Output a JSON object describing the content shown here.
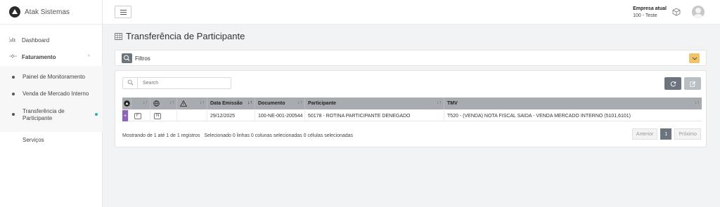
{
  "brand": {
    "name": "Atak Sistemas",
    "icon": "logo-icon"
  },
  "sidebar": {
    "items": [
      {
        "label": "Dashboard",
        "icon": "bar-chart-icon"
      },
      {
        "label": "Faturamento",
        "icon": "handshake-icon",
        "expanded": true,
        "children": [
          {
            "label": "Painel de Monitoramento"
          },
          {
            "label": "Venda de Mercado Interno"
          },
          {
            "label": "Transferência de Participante",
            "active": true
          }
        ]
      },
      {
        "label": "Serviços"
      }
    ]
  },
  "topbar": {
    "company_title": "Empresa atual",
    "company_value": "100 - Teste"
  },
  "page": {
    "title": "Transferência de Participante"
  },
  "filters": {
    "label": "Filtros"
  },
  "table": {
    "search_placeholder": "Search",
    "columns": [
      "",
      "",
      "",
      "",
      "Data Emissão",
      "Documento",
      "Participante",
      "TMV"
    ],
    "rows": [
      {
        "expand": "+",
        "tag1": "F",
        "tag2": "N",
        "data_emissao": "29/12/2025",
        "documento": "100-NE-001-200544",
        "participante": "50178 - ROTINA PARTICIPANTE DENEGADO",
        "tmv": "T520 - (VENDA) NOTA FISCAL SAIDA - VENDA MERCADO INTERNO (5101,6101)"
      }
    ],
    "info": "Mostrando de 1 até 1 de 1 registros",
    "selection": "Selecionado 0 linhas  0 colunas selecionadas  0 células selecionadas"
  },
  "pagination": {
    "prev": "Anterior",
    "current": "1",
    "next": "Próximo"
  },
  "colors": {
    "accent": "#2ab3a6",
    "header": "#a8abaf",
    "filter_toggle": "#f0c36d",
    "expand": "#8e63b8"
  }
}
